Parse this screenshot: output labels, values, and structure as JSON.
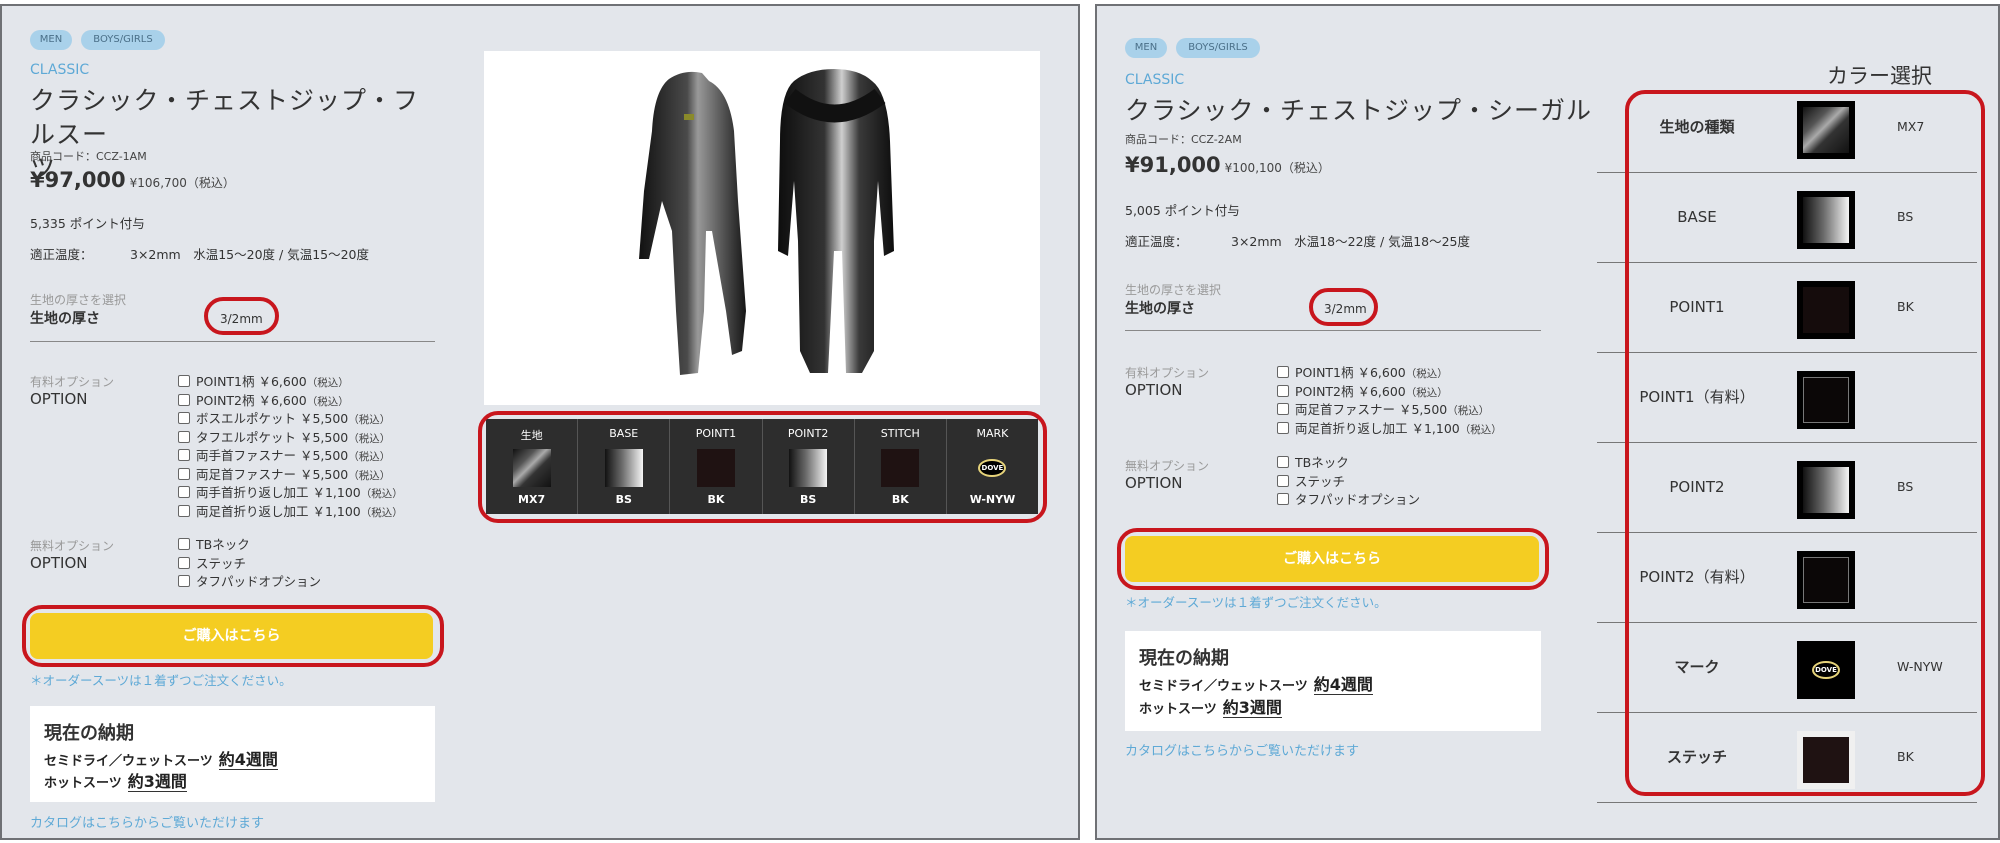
{
  "panel1": {
    "tags": [
      "MEN",
      "BOYS/GIRLS"
    ],
    "series": "CLASSIC",
    "title_line1": "クラシック・チェストジップ・フルスー",
    "title_line2": "ツ",
    "code": "商品コード：CCZ-1AM",
    "price": "¥97,000",
    "price_tax": "¥106,700（税込）",
    "points": "5,335 ポイント付与",
    "temp_label": "適正温度：",
    "temp_value": "3×2mm　水温15〜20度 / 気温15〜20度",
    "thickness_sub": "生地の厚さを選択",
    "thickness_main": "生地の厚さ",
    "thickness_value": "3/2mm",
    "paid_sub": "有料オプション",
    "paid_main": "OPTION",
    "paid_options": [
      {
        "label": "POINT1柄 ￥6,600",
        "tax": "（税込）"
      },
      {
        "label": "POINT2柄 ￥6,600",
        "tax": "（税込）"
      },
      {
        "label": "ボスエルポケット ￥5,500",
        "tax": "（税込）"
      },
      {
        "label": "タフエルポケット ￥5,500",
        "tax": "（税込）"
      },
      {
        "label": "両手首ファスナー ￥5,500",
        "tax": "（税込）"
      },
      {
        "label": "両足首ファスナー ￥5,500",
        "tax": "（税込）"
      },
      {
        "label": "両手首折り返し加工 ￥1,100",
        "tax": "（税込）"
      },
      {
        "label": "両足首折り返し加工 ￥1,100",
        "tax": "（税込）"
      }
    ],
    "free_sub": "無料オプション",
    "free_main": "OPTION",
    "free_options": [
      "TBネック",
      "ステッチ",
      "タフパッドオプション"
    ],
    "buy_label": "ご購入はこちら",
    "note": "＊オーダースーツは１着ずつご注文ください。",
    "delivery_title": "現在の納期",
    "delivery_rows": [
      {
        "label": "セミドライ／ウェットスーツ",
        "value": "約4週間"
      },
      {
        "label": "ホットスーツ",
        "value": "約3週間"
      }
    ],
    "catalog": "カタログはこちらからご覧いただけます",
    "swatches": [
      {
        "caption": "生地",
        "value": "MX7"
      },
      {
        "caption": "BASE",
        "value": "BS"
      },
      {
        "caption": "POINT1",
        "value": "BK"
      },
      {
        "caption": "POINT2",
        "value": "BS"
      },
      {
        "caption": "STITCH",
        "value": "BK"
      },
      {
        "caption": "MARK",
        "value": "W-NYW",
        "mark_text": "DOVE"
      }
    ]
  },
  "panel2": {
    "tags": [
      "MEN",
      "BOYS/GIRLS"
    ],
    "series": "CLASSIC",
    "title": "クラシック・チェストジップ・シーガル",
    "code": "商品コード：CCZ-2AM",
    "price": "¥91,000",
    "price_tax": "¥100,100（税込）",
    "points": "5,005 ポイント付与",
    "temp_label": "適正温度：",
    "temp_value": "3×2mm　水温18〜22度 / 気温18〜25度",
    "thickness_sub": "生地の厚さを選択",
    "thickness_main": "生地の厚さ",
    "thickness_value": "3/2mm",
    "paid_sub": "有料オプション",
    "paid_main": "OPTION",
    "paid_options": [
      {
        "label": "POINT1柄 ￥6,600",
        "tax": "（税込）"
      },
      {
        "label": "POINT2柄 ￥6,600",
        "tax": "（税込）"
      },
      {
        "label": "両足首ファスナー ￥5,500",
        "tax": "（税込）"
      },
      {
        "label": "両足首折り返し加工 ￥1,100",
        "tax": "（税込）"
      }
    ],
    "free_sub": "無料オプション",
    "free_main": "OPTION",
    "free_options": [
      "TBネック",
      "ステッチ",
      "タフパッドオプション"
    ],
    "buy_label": "ご購入はこちら",
    "note": "＊オーダースーツは１着ずつご注文ください。",
    "delivery_title": "現在の納期",
    "delivery_rows": [
      {
        "label": "セミドライ／ウェットスーツ",
        "value": "約4週間"
      },
      {
        "label": "ホットスーツ",
        "value": "約3週間"
      }
    ],
    "catalog": "カタログはこちらからご覧いただけます",
    "color_heading": "カラー選択",
    "color_rows": [
      {
        "name": "生地の種類",
        "value": "MX7"
      },
      {
        "name": "BASE",
        "value": "BS"
      },
      {
        "name": "POINT1",
        "value": "BK"
      },
      {
        "name": "POINT1（有料）",
        "value": ""
      },
      {
        "name": "POINT2",
        "value": "BS"
      },
      {
        "name": "POINT2（有料）",
        "value": ""
      },
      {
        "name": "マーク",
        "value": "W-NYW"
      },
      {
        "name": "ステッチ",
        "value": "BK"
      }
    ]
  },
  "colors": {
    "accent_blue": "#5ea9d6",
    "buy_yellow": "#f4cd22",
    "highlight_red": "#c8161d",
    "tag_blue": "#a9d1ea"
  }
}
